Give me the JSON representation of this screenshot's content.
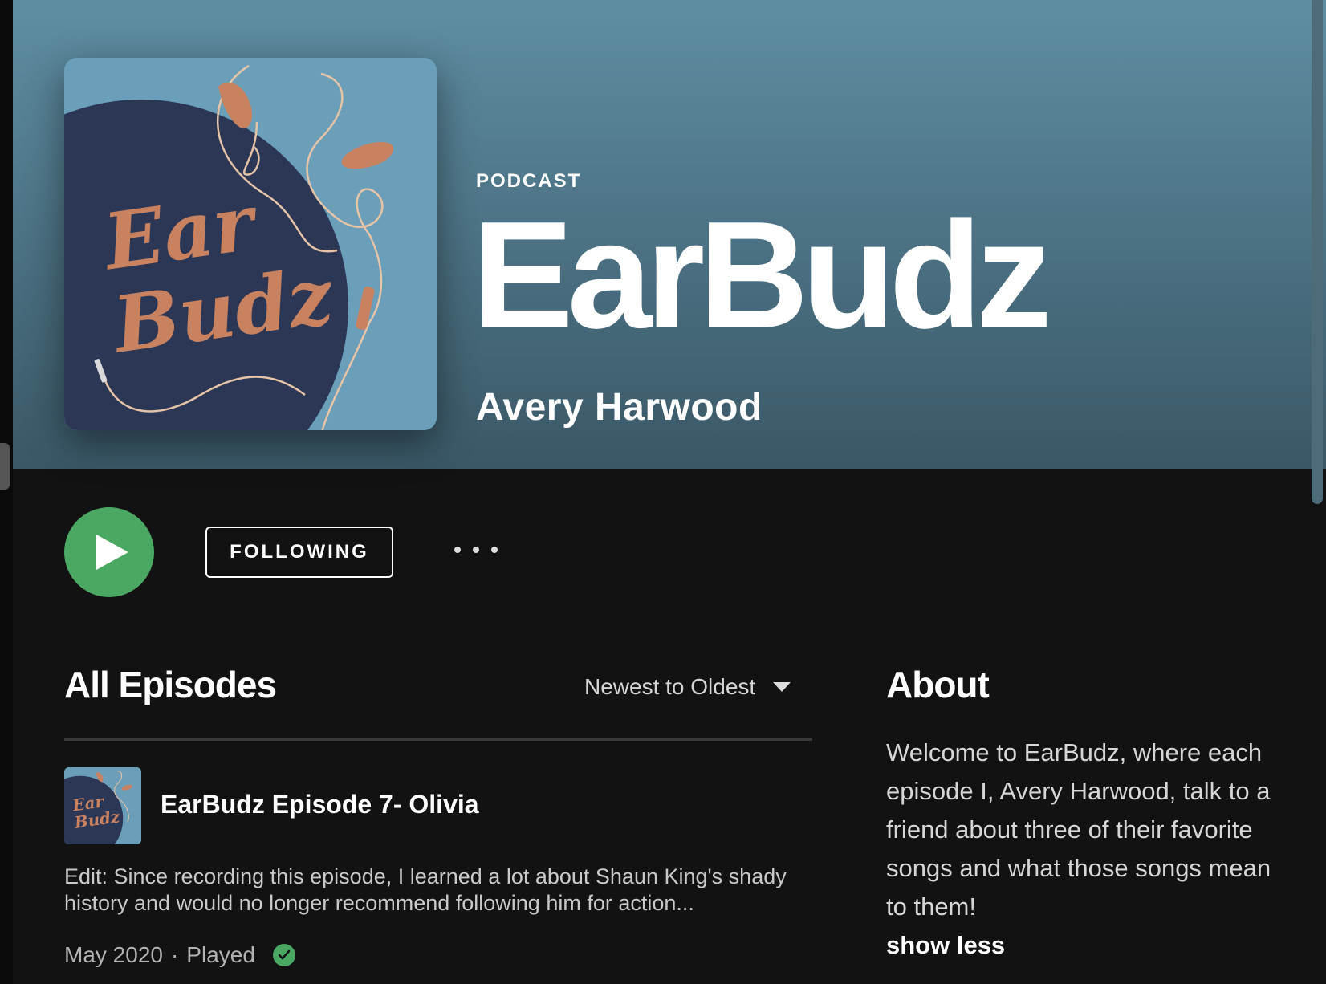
{
  "podcast": {
    "type_label": "PODCAST",
    "title": "EarBudz",
    "author": "Avery Harwood",
    "cover_text_line1": "Ear",
    "cover_text_line2": "Budz"
  },
  "actions": {
    "play_icon": "play-icon",
    "follow_label": "FOLLOWING",
    "more_icon": "more-options-icon"
  },
  "episodes": {
    "heading": "All Episodes",
    "sort_label": "Newest to Oldest",
    "items": [
      {
        "title": "EarBudz Episode 7- Olivia",
        "description": "Edit: Since recording this episode, I learned a lot about Shaun King's shady history and would no longer recommend following him for action...",
        "date": "May 2020",
        "separator": "·",
        "status": "Played"
      }
    ]
  },
  "about": {
    "heading": "About",
    "text": "Welcome to EarBudz, where each episode I, Avery Harwood, talk to a friend about three of their favorite songs and what those songs mean to them!",
    "toggle_label": "show less"
  },
  "colors": {
    "header_top": "#5f8ea3",
    "accent_green": "#4aa862",
    "cover_bg": "#6b9eb8",
    "cover_circle": "#2c3756",
    "cover_text": "#c9825f"
  }
}
